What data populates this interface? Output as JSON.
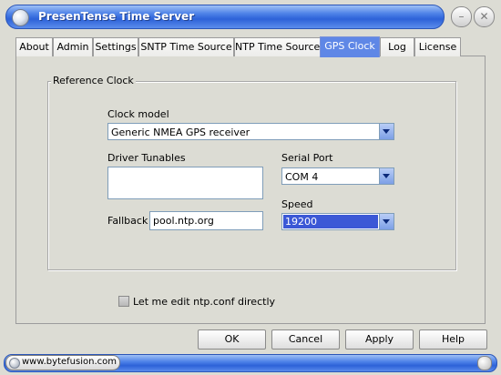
{
  "window": {
    "title": "PresenTense Time Server",
    "minimize_label": "–",
    "close_label": "✕"
  },
  "tabs": [
    {
      "label": "About"
    },
    {
      "label": "Admin"
    },
    {
      "label": "Settings"
    },
    {
      "label": "SNTP Time Source"
    },
    {
      "label": "NTP Time Source"
    },
    {
      "label": "GPS Clock"
    },
    {
      "label": "Log"
    },
    {
      "label": "License"
    }
  ],
  "active_tab": "GPS Clock",
  "reference_clock": {
    "group_label": "Reference Clock",
    "clock_model_label": "Clock model",
    "clock_model_value": "Generic NMEA GPS receiver",
    "driver_tunables_label": "Driver  Tunables",
    "driver_tunables_value": "",
    "serial_port_label": "Serial Port",
    "serial_port_value": "COM 4",
    "speed_label": "Speed",
    "speed_value": "19200",
    "fallback_label": "Fallback",
    "fallback_value": "pool.ntp.org"
  },
  "edit_ntpconf": {
    "label": "Let me edit ntp.conf directly",
    "checked": false
  },
  "buttons": {
    "ok": "OK",
    "cancel": "Cancel",
    "apply": "Apply",
    "help": "Help"
  },
  "statusbar": {
    "link": "www.bytefusion.com"
  },
  "colors": {
    "titlebar": "#2d62d8",
    "active_tab": "#5f87e6",
    "selection": "#3b58d6"
  }
}
